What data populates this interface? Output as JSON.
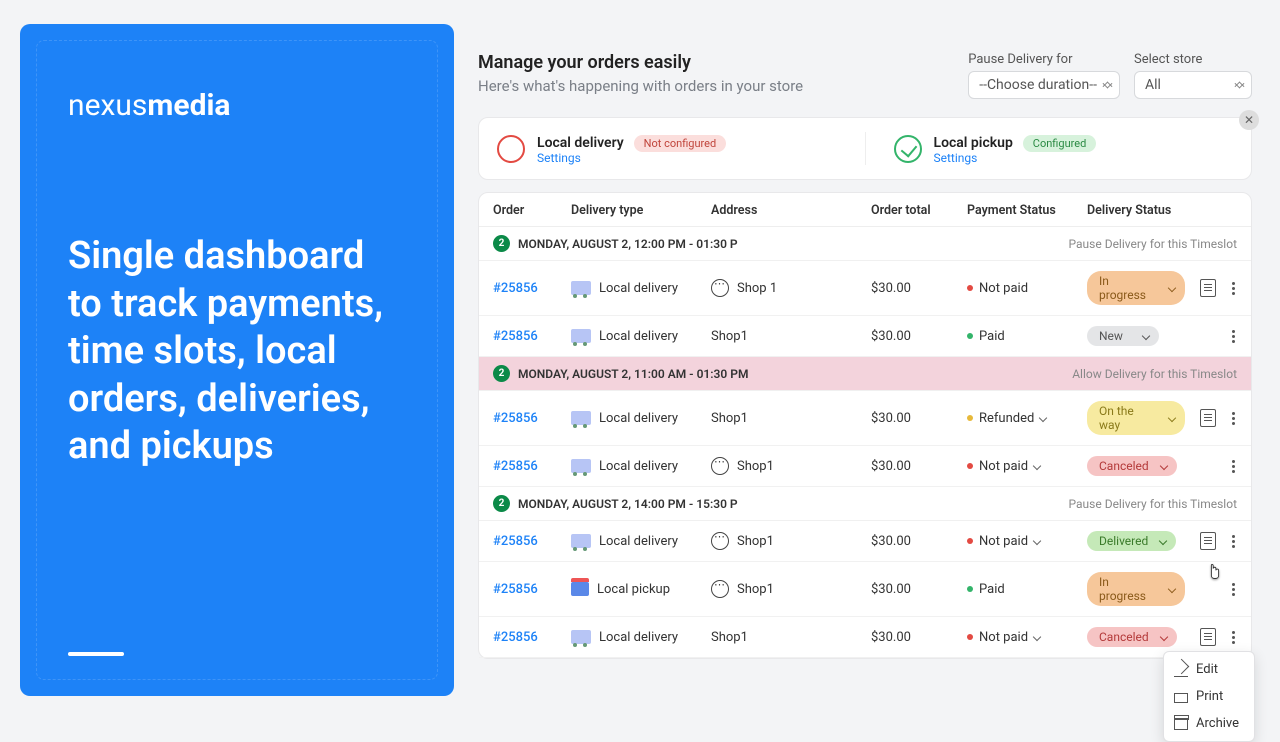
{
  "brand": {
    "first": "nexus",
    "second": "media"
  },
  "tagline": "Single dashboard to track payments, time slots, local orders, deliveries, and pickups",
  "header": {
    "title": "Manage your orders easily",
    "subtitle": "Here's what's happening with orders in your store"
  },
  "selects": {
    "pause_label": "Pause Delivery for",
    "pause_value": "--Choose duration--",
    "store_label": "Select store",
    "store_value": "All"
  },
  "method_cards": {
    "delivery": {
      "title": "Local delivery",
      "settings": "Settings",
      "badge": "Not configured"
    },
    "pickup": {
      "title": "Local pickup",
      "settings": "Settings",
      "badge": "Configured"
    }
  },
  "columns": {
    "order": "Order",
    "dtype": "Delivery type",
    "address": "Address",
    "total": "Order total",
    "payment": "Payment Status",
    "delivery": "Delivery Status"
  },
  "groups": [
    {
      "count": "2",
      "label": "MONDAY, AUGUST 2, 12:00 PM - 01:30 P",
      "action": "Pause Delivery for this Timeslot",
      "paused": false,
      "rows": [
        {
          "order": "#25856",
          "type": "Local delivery",
          "icon": "truck",
          "addr": "Shop 1",
          "chat": true,
          "total": "$30.00",
          "pdot": "red",
          "pay": "Not paid",
          "pchev": false,
          "pill": "In progress",
          "pcolor": "orange",
          "doc": true
        },
        {
          "order": "#25856",
          "type": "Local delivery",
          "icon": "truck",
          "addr": "Shop1",
          "chat": false,
          "total": "$30.00",
          "pdot": "grn",
          "pay": "Paid",
          "pchev": false,
          "pill": "New",
          "pcolor": "gray",
          "doc": false
        }
      ]
    },
    {
      "count": "2",
      "label": "MONDAY, AUGUST 2, 11:00 AM - 01:30 PM",
      "action": "Allow Delivery for this Timeslot",
      "paused": true,
      "rows": [
        {
          "order": "#25856",
          "type": "Local delivery",
          "icon": "truck",
          "addr": "Shop1",
          "chat": false,
          "total": "$30.00",
          "pdot": "yel",
          "pay": "Refunded",
          "pchev": true,
          "pill": "On the way",
          "pcolor": "yellow",
          "doc": true
        },
        {
          "order": "#25856",
          "type": "Local delivery",
          "icon": "truck",
          "addr": "Shop1",
          "chat": true,
          "total": "$30.00",
          "pdot": "red",
          "pay": "Not paid",
          "pchev": true,
          "pill": "Canceled",
          "pcolor": "redp",
          "doc": false
        }
      ]
    },
    {
      "count": "2",
      "label": "MONDAY, AUGUST 2, 14:00 PM - 15:30 P",
      "action": "Pause Delivery for this Timeslot",
      "paused": false,
      "rows": [
        {
          "order": "#25856",
          "type": "Local delivery",
          "icon": "truck",
          "addr": "Shop1",
          "chat": true,
          "total": "$30.00",
          "pdot": "red",
          "pay": "Not paid",
          "pchev": true,
          "pill": "Delivered",
          "pcolor": "greenp",
          "doc": true
        },
        {
          "order": "#25856",
          "type": "Local pickup",
          "icon": "gift",
          "addr": "Shop1",
          "chat": true,
          "total": "$30.00",
          "pdot": "grn",
          "pay": "Paid",
          "pchev": false,
          "pill": "In progress",
          "pcolor": "orange",
          "doc": false
        },
        {
          "order": "#25856",
          "type": "Local delivery",
          "icon": "truck",
          "addr": "Shop1",
          "chat": false,
          "total": "$30.00",
          "pdot": "red",
          "pay": "Not paid",
          "pchev": true,
          "pill": "Canceled",
          "pcolor": "redp",
          "doc": true,
          "menu": true
        }
      ]
    }
  ],
  "menu": {
    "edit": "Edit",
    "print": "Print",
    "archive": "Archive"
  }
}
